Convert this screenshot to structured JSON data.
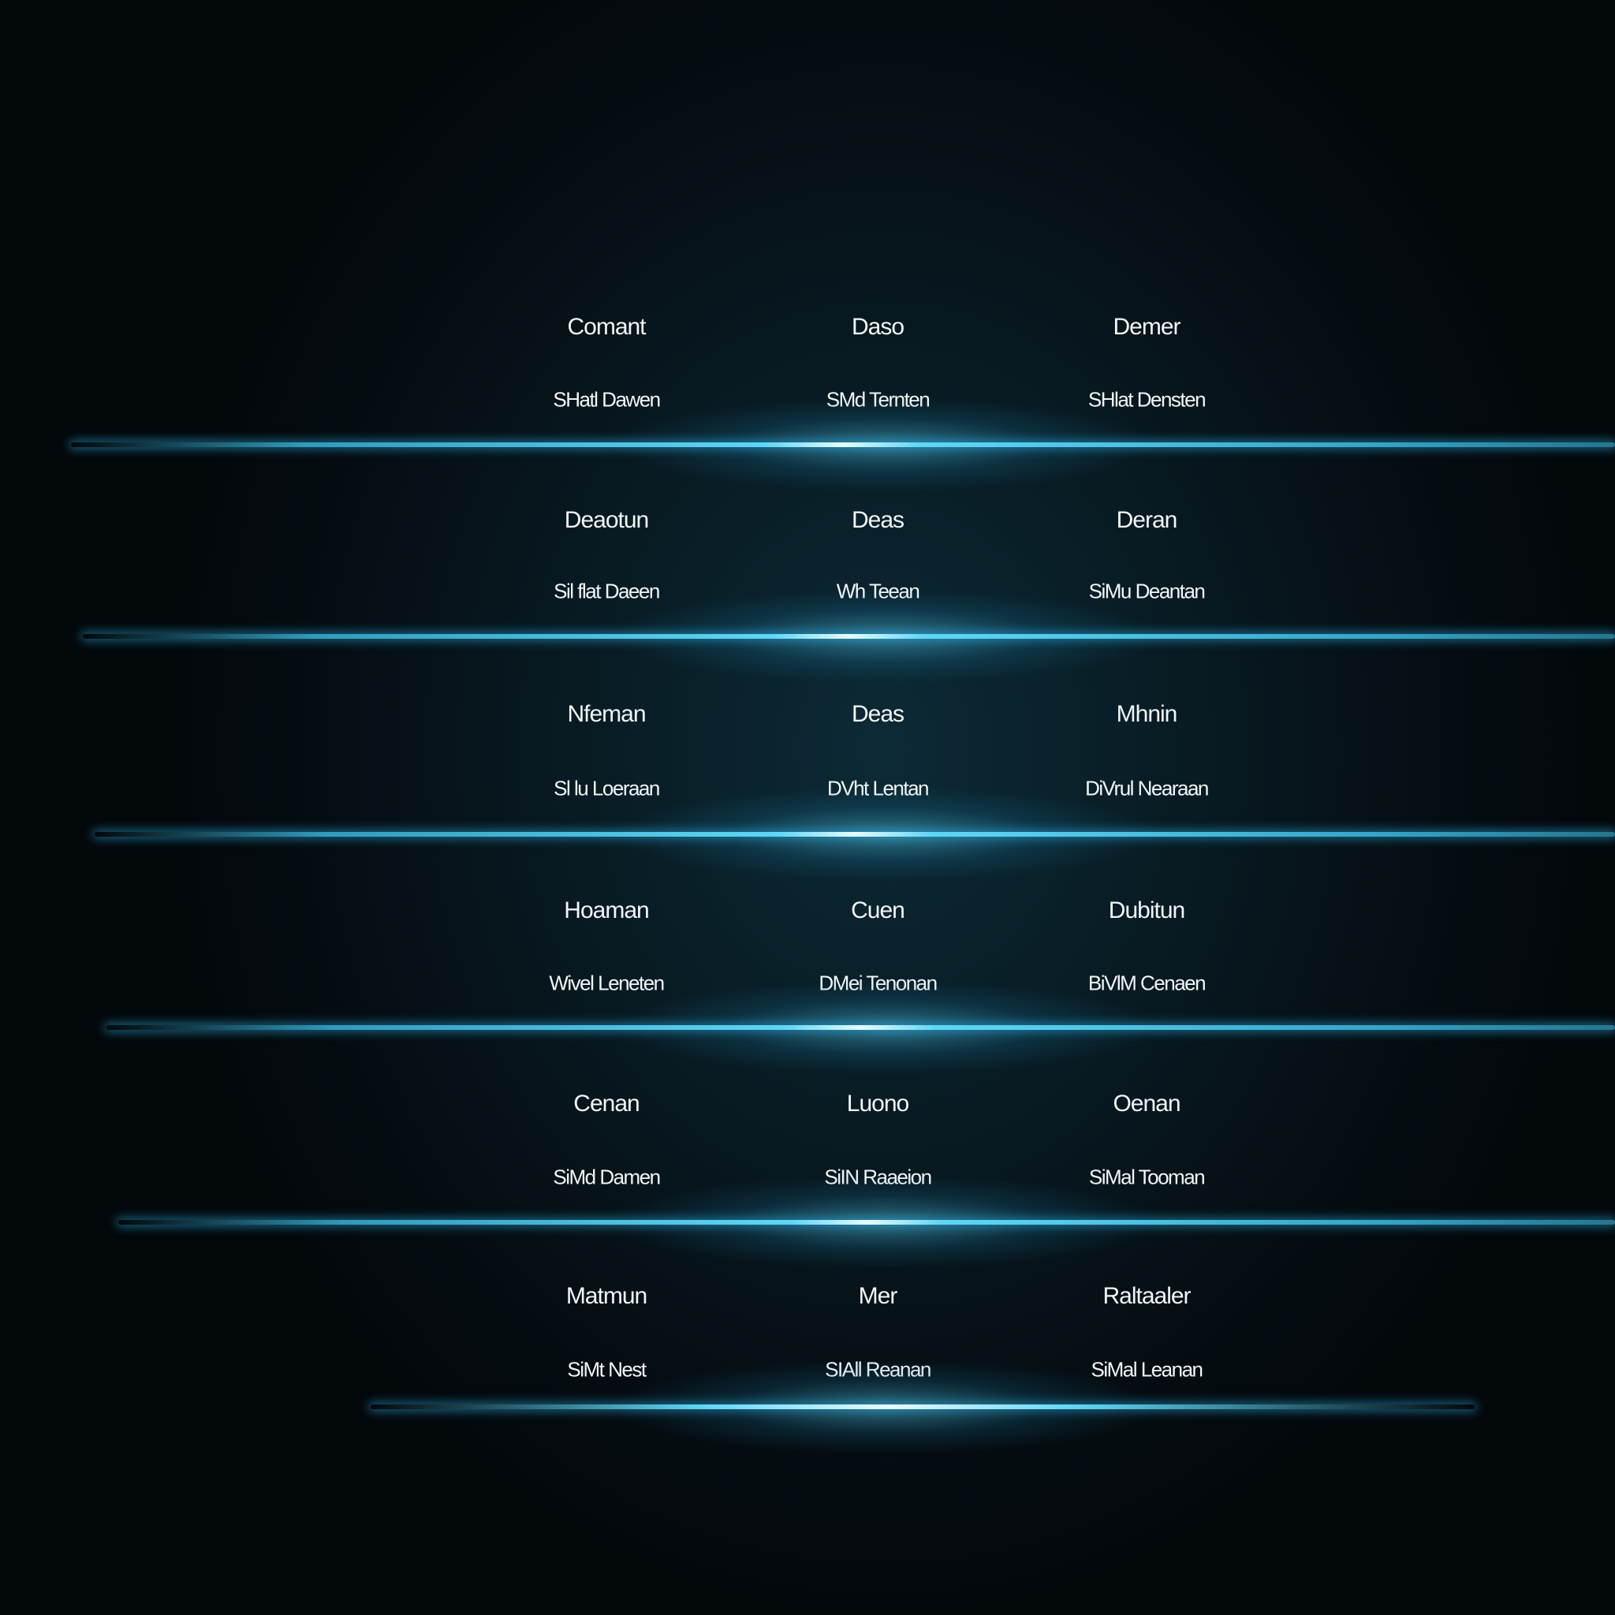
{
  "accent_color": "#5fd6f5",
  "rows": [
    {
      "cells": [
        {
          "title": "Comant",
          "subtitle": "SHatl Dawen"
        },
        {
          "title": "Daso",
          "subtitle": "SMd Ternten"
        },
        {
          "title": "Demer",
          "subtitle": "SHlat Densten"
        }
      ]
    },
    {
      "cells": [
        {
          "title": "Deaotun",
          "subtitle": "Sil flat Daeen"
        },
        {
          "title": "Deas",
          "subtitle": "Wh Teean"
        },
        {
          "title": "Deran",
          "subtitle": "SiMu Deantan"
        }
      ]
    },
    {
      "cells": [
        {
          "title": "Nfeman",
          "subtitle": "Sl lu Loeraan"
        },
        {
          "title": "Deas",
          "subtitle": "DVht Lentan"
        },
        {
          "title": "Mhnin",
          "subtitle": "DiVrul Nearaan"
        }
      ]
    },
    {
      "cells": [
        {
          "title": "Hoaman",
          "subtitle": "Wivel Leneten"
        },
        {
          "title": "Cuen",
          "subtitle": "DMei Tenonan"
        },
        {
          "title": "Dubitun",
          "subtitle": "BiVlM Cenaen"
        }
      ]
    },
    {
      "cells": [
        {
          "title": "Cenan",
          "subtitle": "SiMd Damen"
        },
        {
          "title": "Luono",
          "subtitle": "SiIN Raaeion"
        },
        {
          "title": "Oenan",
          "subtitle": "SiMal Tooman"
        }
      ]
    },
    {
      "cells": [
        {
          "title": "Matmun",
          "subtitle": "SiMt Nest"
        },
        {
          "title": "Mer",
          "subtitle": "SIAll Reanan"
        },
        {
          "title": "Raltaaler",
          "subtitle": "SiMal Leanan"
        }
      ]
    }
  ]
}
